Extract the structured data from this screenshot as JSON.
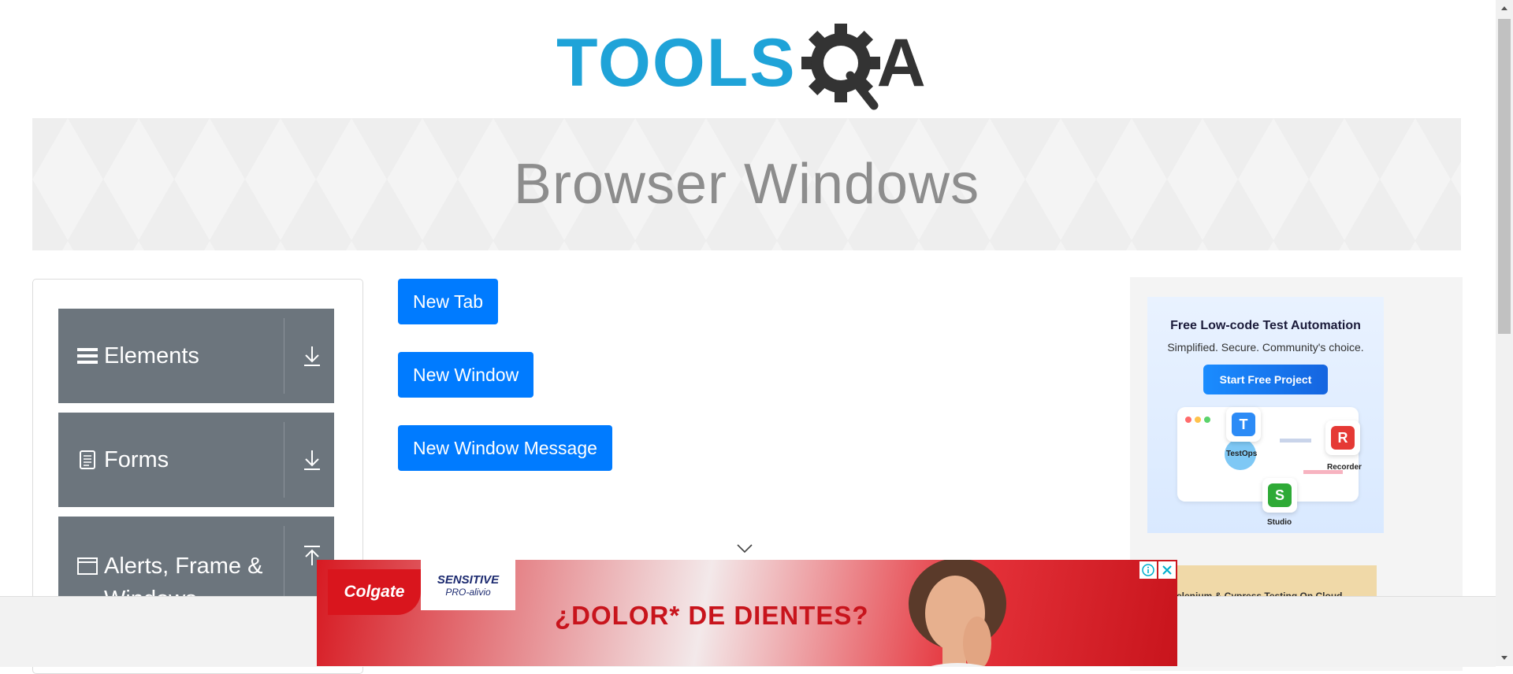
{
  "logo": {
    "text_main": "TOOLS",
    "text_end": "A",
    "colors": {
      "blue": "#1fa3d8",
      "dark": "#333333"
    }
  },
  "banner": {
    "title": "Browser Windows"
  },
  "sidebar": {
    "groups": [
      {
        "label": "Elements",
        "icon": "menu-icon",
        "arrow": "download-icon"
      },
      {
        "label": "Forms",
        "icon": "document-icon",
        "arrow": "download-icon"
      },
      {
        "label": "Alerts, Frame & Windows",
        "icon": "window-icon",
        "arrow": "upload-icon"
      }
    ]
  },
  "buttons": {
    "new_tab": "New Tab",
    "new_window": "New Window",
    "new_window_message": "New Window Message"
  },
  "ad_right": {
    "title": "Free Low-code Test Automation",
    "subtitle": "Simplified. Secure. Community's choice.",
    "cta": "Start Free Project",
    "tiles": {
      "testops": "TestOps",
      "recorder": "Recorder",
      "studio": "Studio"
    },
    "secondary_text": "Selenium & Cypress Testing On Cloud"
  },
  "ad_bottom": {
    "brand": "Colgate",
    "product_line1": "SENSITIVE",
    "product_line2": "PRO-alivio",
    "headline": "¿DOLOR* DE DIENTES?"
  },
  "colors": {
    "primary": "#007bff",
    "sidebar": "#6c757d"
  }
}
